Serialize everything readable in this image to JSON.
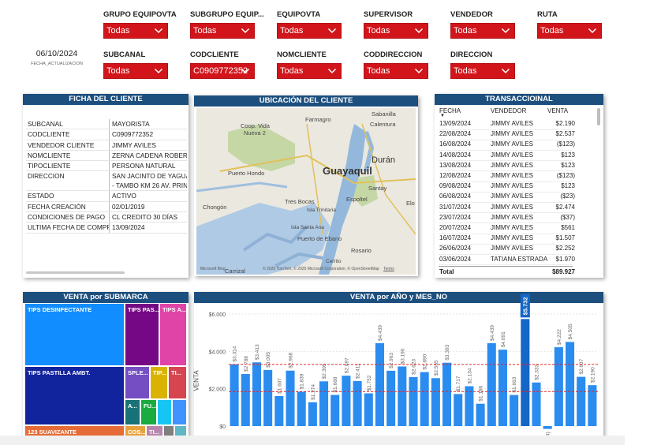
{
  "date": {
    "value": "06/10/2024",
    "label": "FECHA_ACTUALIZACION"
  },
  "filters": [
    {
      "label": "GRUPO EQUIPOVTA",
      "value": "Todas"
    },
    {
      "label": "SUBGRUPO EQUIP...",
      "value": "Todas"
    },
    {
      "label": "EQUIPOVTA",
      "value": "Todas"
    },
    {
      "label": "SUPERVISOR",
      "value": "Todas"
    },
    {
      "label": "VENDEDOR",
      "value": "Todas"
    },
    {
      "label": "RUTA",
      "value": "Todas"
    },
    {
      "label": "SUBCANAL",
      "value": "Todas"
    },
    {
      "label": "CODCLIENTE",
      "value": "C0909772352"
    },
    {
      "label": "NOMCLIENTE",
      "value": "Todas"
    },
    {
      "label": "CODDIRECCION",
      "value": "Todas"
    },
    {
      "label": "DIRECCION",
      "value": "Todas"
    }
  ],
  "ficha": {
    "title": "FICHA DEL CLIENTE",
    "rows": [
      {
        "k": "SUBCANAL",
        "v": "MAYORISTA"
      },
      {
        "k": "CODCLIENTE",
        "v": "C0909772352"
      },
      {
        "k": "VENDEDOR CLIENTE",
        "v": "JIMMY AVILES"
      },
      {
        "k": "NOMCLIENTE",
        "v": "ZERNA CADENA ROBERTO"
      },
      {
        "k": "TIPOCLIENTE",
        "v": "PERSONA NATURAL"
      },
      {
        "k": "DIRECCION",
        "v": "SAN JACINTO DE YAGUACHI",
        "v2": "- TAMBO KM 26 AV. PRINC"
      },
      {
        "k": "ESTADO",
        "v": "ACTIVO"
      },
      {
        "k": "FECHA CREACIÓN",
        "v": "02/01/2019"
      },
      {
        "k": "CONDICIONES DE PAGO",
        "v": "CL CREDITO 30 DÍAS"
      },
      {
        "k": "ULTIMA FECHA DE COMPRA",
        "v": "13/09/2024"
      }
    ]
  },
  "map": {
    "title": "UBICACIÓN DEL CLIENTE",
    "labels": [
      "Farmagro",
      "Sabanilla",
      "Calentura",
      "Coop. Vida",
      "Nueva 2",
      "Guayaquil",
      "Durán",
      "Puerto Hondo",
      "Santay",
      "Chongón",
      "Tres Bocas",
      "Isla Trinitaria",
      "Espoltel",
      "Elo",
      "Isla Santa Ana",
      "Puerto de Ebano",
      "Rosario",
      "Cerrito",
      "Carrizal"
    ],
    "attribution": "© 2025 TomTom, © 2025 Microsoft Corporation, © OpenStreetMap",
    "terms": "Terms",
    "logo": "Microsoft Bing"
  },
  "trans": {
    "title": "TRANSACCIOINAL",
    "cols": [
      "FECHA",
      "VENDEDOR",
      "VENTA"
    ],
    "rows": [
      [
        "13/09/2024",
        "JIMMY AVILES",
        "$2.190"
      ],
      [
        "22/08/2024",
        "JIMMY AVILES",
        "$2.537"
      ],
      [
        "16/08/2024",
        "JIMMY AVILES",
        "($123)"
      ],
      [
        "14/08/2024",
        "JIMMY AVILES",
        "$123"
      ],
      [
        "13/08/2024",
        "JIMMY AVILES",
        "$123"
      ],
      [
        "12/08/2024",
        "JIMMY AVILES",
        "($123)"
      ],
      [
        "09/08/2024",
        "JIMMY AVILES",
        "$123"
      ],
      [
        "06/08/2024",
        "JIMMY AVILES",
        "($23)"
      ],
      [
        "31/07/2024",
        "JIMMY AVILES",
        "$2.474"
      ],
      [
        "23/07/2024",
        "JIMMY AVILES",
        "($37)"
      ],
      [
        "20/07/2024",
        "JIMMY AVILES",
        "$561"
      ],
      [
        "16/07/2024",
        "JIMMY AVILES",
        "$1.507"
      ],
      [
        "26/06/2024",
        "JIMMY AVILES",
        "$2.252"
      ],
      [
        "03/06/2024",
        "TATIANA ESTRADA",
        "$1.970"
      ]
    ],
    "total_label": "Total",
    "total_value": "$89.927"
  },
  "treemap": {
    "title": "VENTA por SUBMARCA",
    "items": [
      "TIPS DESINFECTANTE",
      "TIPS PAS...",
      "TIPS A...",
      "TIPS PASTILLA AMBT.",
      "SPLE...",
      "TIP...",
      "TI...",
      "A...",
      "FU...",
      "123 SUAVIZANTE",
      "COS...",
      "TI..."
    ]
  },
  "chart_data": {
    "type": "bar",
    "title": "VENTA por AÑO y MES_NO",
    "ylabel": "VENTA",
    "xlabel": "",
    "ylim": [
      -400,
      6000
    ],
    "yticks": [
      "$6.000",
      "$4.000",
      "$2.000",
      "$0"
    ],
    "values": [
      3314,
      2788,
      3413,
      3005,
      1607,
      2968,
      1839,
      1274,
      2395,
      1668,
      2697,
      2411,
      1752,
      4439,
      2963,
      3190,
      2623,
      2890,
      2565,
      3393,
      1717,
      2134,
      1196,
      4439,
      4091,
      1663,
      5732,
      2333,
      -154,
      4222,
      4505,
      2637,
      2190
    ],
    "labels": [
      "$3.314",
      "$2.788",
      "$3.413",
      "$3.005",
      "$1.607",
      "$2.968",
      "$1.839",
      "$1.274",
      "$2.395",
      "$1.668",
      "$2.697",
      "$2.411",
      "$1.752",
      "$4.439",
      "$2.963",
      "$3.190",
      "$2.623",
      "$2.890",
      "$2.565",
      "$3.393",
      "$1.717",
      "$2.134",
      "$1.196",
      "$4.439",
      "$4.091",
      "$1.663",
      "$5.732",
      "$2.333",
      "($154)",
      "$4.222",
      "$4.505",
      "$2.637",
      "$2.190"
    ],
    "highlight_index": 26,
    "reference_lines": [
      3300,
      1850
    ],
    "colors": {
      "bar": "#2b8cf0",
      "highlight": "#1466c7",
      "ref": "#e0272b"
    }
  }
}
